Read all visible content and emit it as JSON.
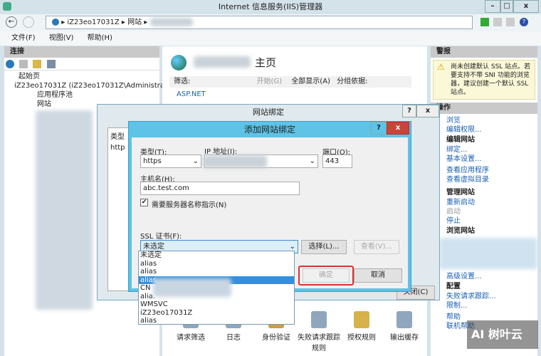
{
  "window": {
    "title": "Internet 信息服务(IIS)管理器",
    "min": "–",
    "max": "□",
    "close": "x"
  },
  "address": {
    "crumbs": [
      "iZ23eo17031Z",
      "网站"
    ],
    "sep": "▸"
  },
  "menu": [
    "文件(F)",
    "视图(V)",
    "帮助(H)"
  ],
  "connections": {
    "header": "连接",
    "tree": [
      "起始页",
      "iZ23eo17031Z (iZ23eo17031Z\\Administrato",
      "应用程序池",
      "网站"
    ]
  },
  "center": {
    "title_suffix": "主页",
    "filter_label": "筛选:",
    "start": "开始(G)",
    "show_all": "全部显示(A)",
    "group_by": "分组依据:",
    "group": "ASP.NET",
    "features": [
      "请求筛选",
      "日志",
      "身份验证",
      "失败请求跟踪规则",
      "授权规则",
      "输出缓存"
    ]
  },
  "alerts": {
    "header": "警报",
    "text": "尚未创建默认 SSL 站点。若要支持不带 SNI 功能的浏览器，建议创建一个默认 SSL 站点。"
  },
  "actions": {
    "header": "操作",
    "items": [
      "浏览",
      "编辑权限..."
    ],
    "edit_site": "编辑网站",
    "edit_items": [
      "绑定...",
      "基本设置...",
      "查看应用程序",
      "查看虚拟目录"
    ],
    "manage": "管理网站",
    "manage_items": [
      "重新启动",
      "启动",
      "停止"
    ],
    "browse": "浏览网站",
    "advanced": "高级设置...",
    "config": "配置",
    "config_items": [
      "失败请求跟踪...",
      "限制..."
    ],
    "help": [
      "帮助",
      "联机帮助"
    ]
  },
  "bindings_dialog": {
    "title": "网站绑定",
    "col_type": "类型",
    "row_type": "http",
    "help": "?",
    "close": "x",
    "close_btn": "关闭(C)"
  },
  "add_dialog": {
    "title": "添加网站绑定",
    "help": "?",
    "close": "x",
    "type_label": "类型(T):",
    "type_value": "https",
    "ip_label": "IP 地址(I):",
    "port_label": "端口(O):",
    "port_value": "443",
    "host_label": "主机名(H):",
    "host_value": "abc.test.com",
    "sni_label": "需要服务器名称指示(N)",
    "sni_checked": true,
    "ssl_label": "SSL 证书(F):",
    "ssl_value": "未选定",
    "select_btn": "选择(L)...",
    "view_btn": "查看(V)...",
    "ok_btn": "确定",
    "cancel_btn": "取消",
    "options": [
      "未选定",
      "alias",
      "alias",
      "alias",
      "CN",
      "alia.",
      "WMSVC",
      "iZ23eo17031Z",
      "alias"
    ],
    "selected_index": 3
  },
  "watermark": "AI 树叶云"
}
